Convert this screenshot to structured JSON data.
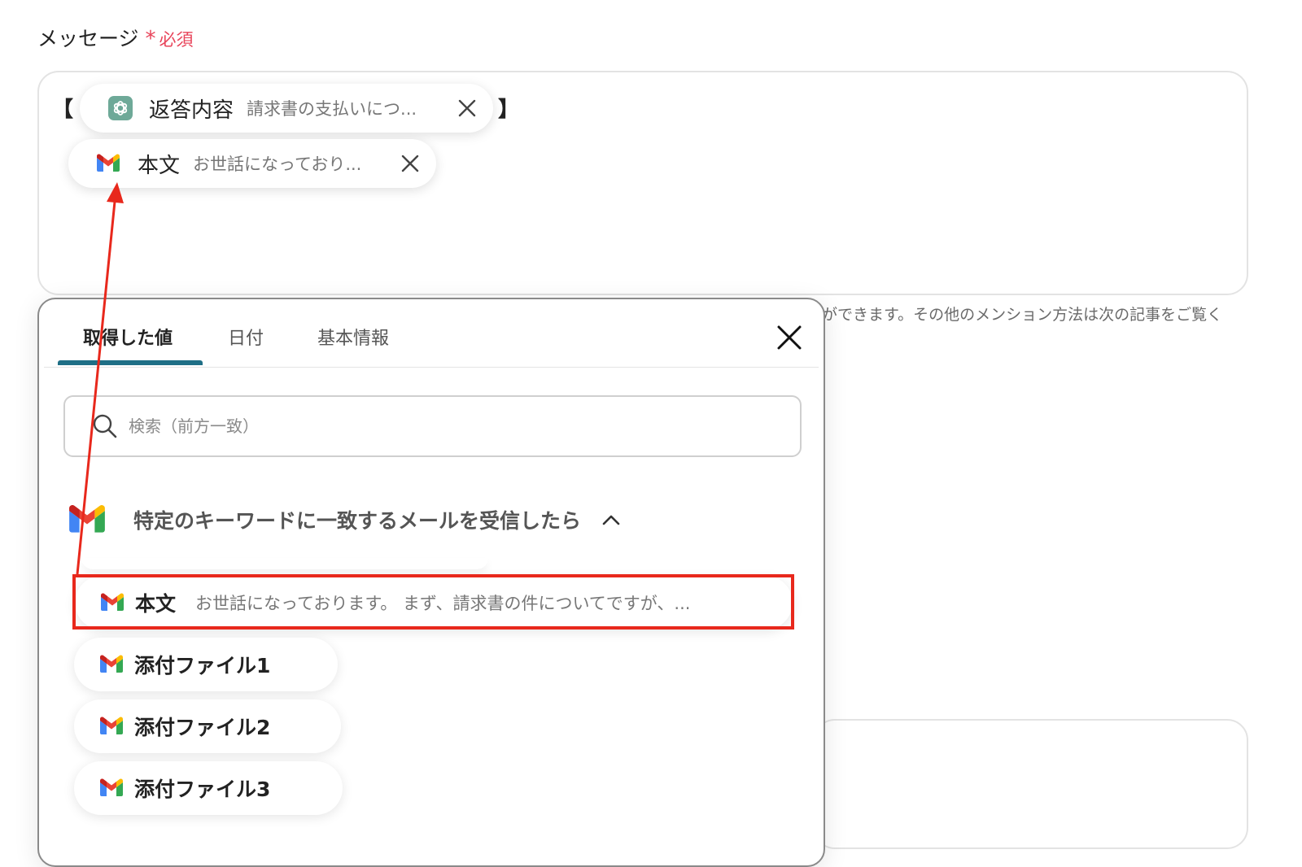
{
  "field": {
    "label": "メッセージ",
    "required_mark": "*",
    "required_text": "必須",
    "bracket_open": "【",
    "bracket_close": "】"
  },
  "pills": [
    {
      "icon": "chatgpt-icon",
      "label": "返答内容",
      "value": "請求書の支払いにつ..."
    },
    {
      "icon": "gmail-icon",
      "label": "本文",
      "value": "お世話になっており..."
    }
  ],
  "hint": "ができます。その他のメンション方法は次の記事をご覧く",
  "popover": {
    "tabs": [
      {
        "label": "取得した値",
        "active": true
      },
      {
        "label": "日付",
        "active": false
      },
      {
        "label": "基本情報",
        "active": false
      }
    ],
    "search_placeholder": "検索（前方一致）",
    "section_title": "特定のキーワードに一致するメールを受信したら",
    "items": [
      {
        "label": "本文",
        "value": "お世話になっております。 まず、請求書の件についてですが、..."
      },
      {
        "label": "添付ファイル1",
        "value": ""
      },
      {
        "label": "添付ファイル2",
        "value": ""
      },
      {
        "label": "添付ファイル3",
        "value": ""
      }
    ]
  },
  "colors": {
    "required": "#e8445a",
    "tab_underline": "#1f6f86",
    "highlight": "#e8281c"
  }
}
